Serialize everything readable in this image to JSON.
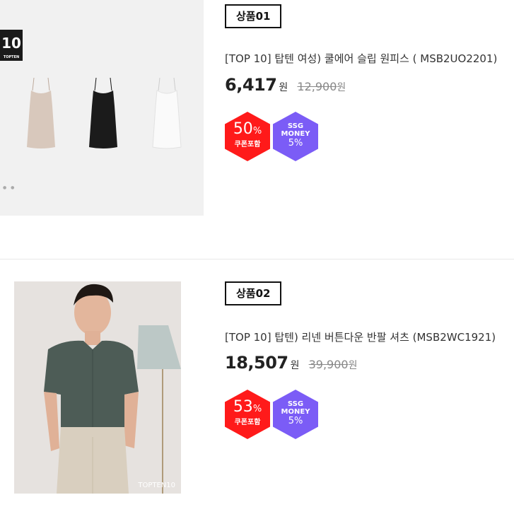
{
  "products": [
    {
      "tag": "상품01",
      "title": "[TOP 10] 탑텐 여성) 쿨에어 슬립 원피스 ( MSB2UO2201)",
      "price": "6,417",
      "currency": "원",
      "original_price": "12,900",
      "original_currency": "원",
      "discount": "50",
      "discount_unit": "%",
      "discount_note": "쿠폰포함",
      "money_line1": "SSG",
      "money_line2": "MONEY",
      "money_pct": "5%",
      "image": {
        "logo": "10",
        "logo_sub": "TOPTEN"
      }
    },
    {
      "tag": "상품02",
      "title": "[TOP 10] 탑텐) 리넨 버튼다운 반팔 셔츠 (MSB2WC1921)",
      "price": "18,507",
      "currency": "원",
      "original_price": "39,900",
      "original_currency": "원",
      "discount": "53",
      "discount_unit": "%",
      "discount_note": "쿠폰포함",
      "money_line1": "SSG",
      "money_line2": "MONEY",
      "money_pct": "5%",
      "image": {
        "watermark": "TOPTEN10"
      }
    }
  ],
  "colors": {
    "sale_badge": "#ff1a1a",
    "money_badge": "#7b5cf6"
  }
}
